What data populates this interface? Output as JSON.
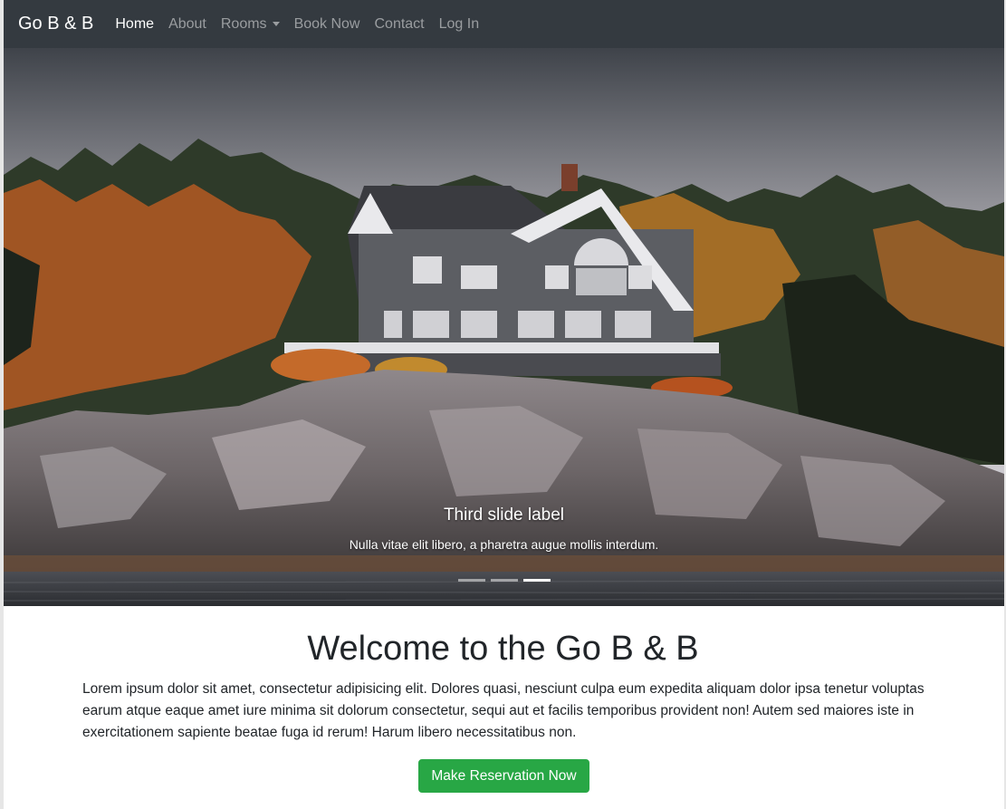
{
  "navbar": {
    "brand": "Go B & B",
    "items": [
      {
        "label": "Home",
        "active": true
      },
      {
        "label": "About"
      },
      {
        "label": "Rooms",
        "dropdown": true
      },
      {
        "label": "Book Now"
      },
      {
        "label": "Contact"
      },
      {
        "label": "Log In"
      }
    ]
  },
  "carousel": {
    "slide_image": "house-on-rocky-shore-autumn-forest",
    "caption_title": "Third slide label",
    "caption_text": "Nulla vitae elit libero, a pharetra augue mollis interdum.",
    "indicator_count": 3,
    "active_indicator": 3
  },
  "main": {
    "heading": "Welcome to the Go B & B",
    "body": "Lorem ipsum dolor sit amet, consectetur adipisicing elit. Dolores quasi, nesciunt culpa eum expedita aliquam dolor ipsa tenetur voluptas earum atque eaque amet iure minima sit dolorum consectetur, sequi aut et facilis temporibus provident non! Autem sed maiores iste in exercitationem sapiente beatae fuga id rerum! Harum libero necessitatibus non.",
    "cta_label": "Make Reservation Now"
  },
  "colors": {
    "navbar_bg": "#343a40",
    "cta_bg": "#28a745"
  }
}
